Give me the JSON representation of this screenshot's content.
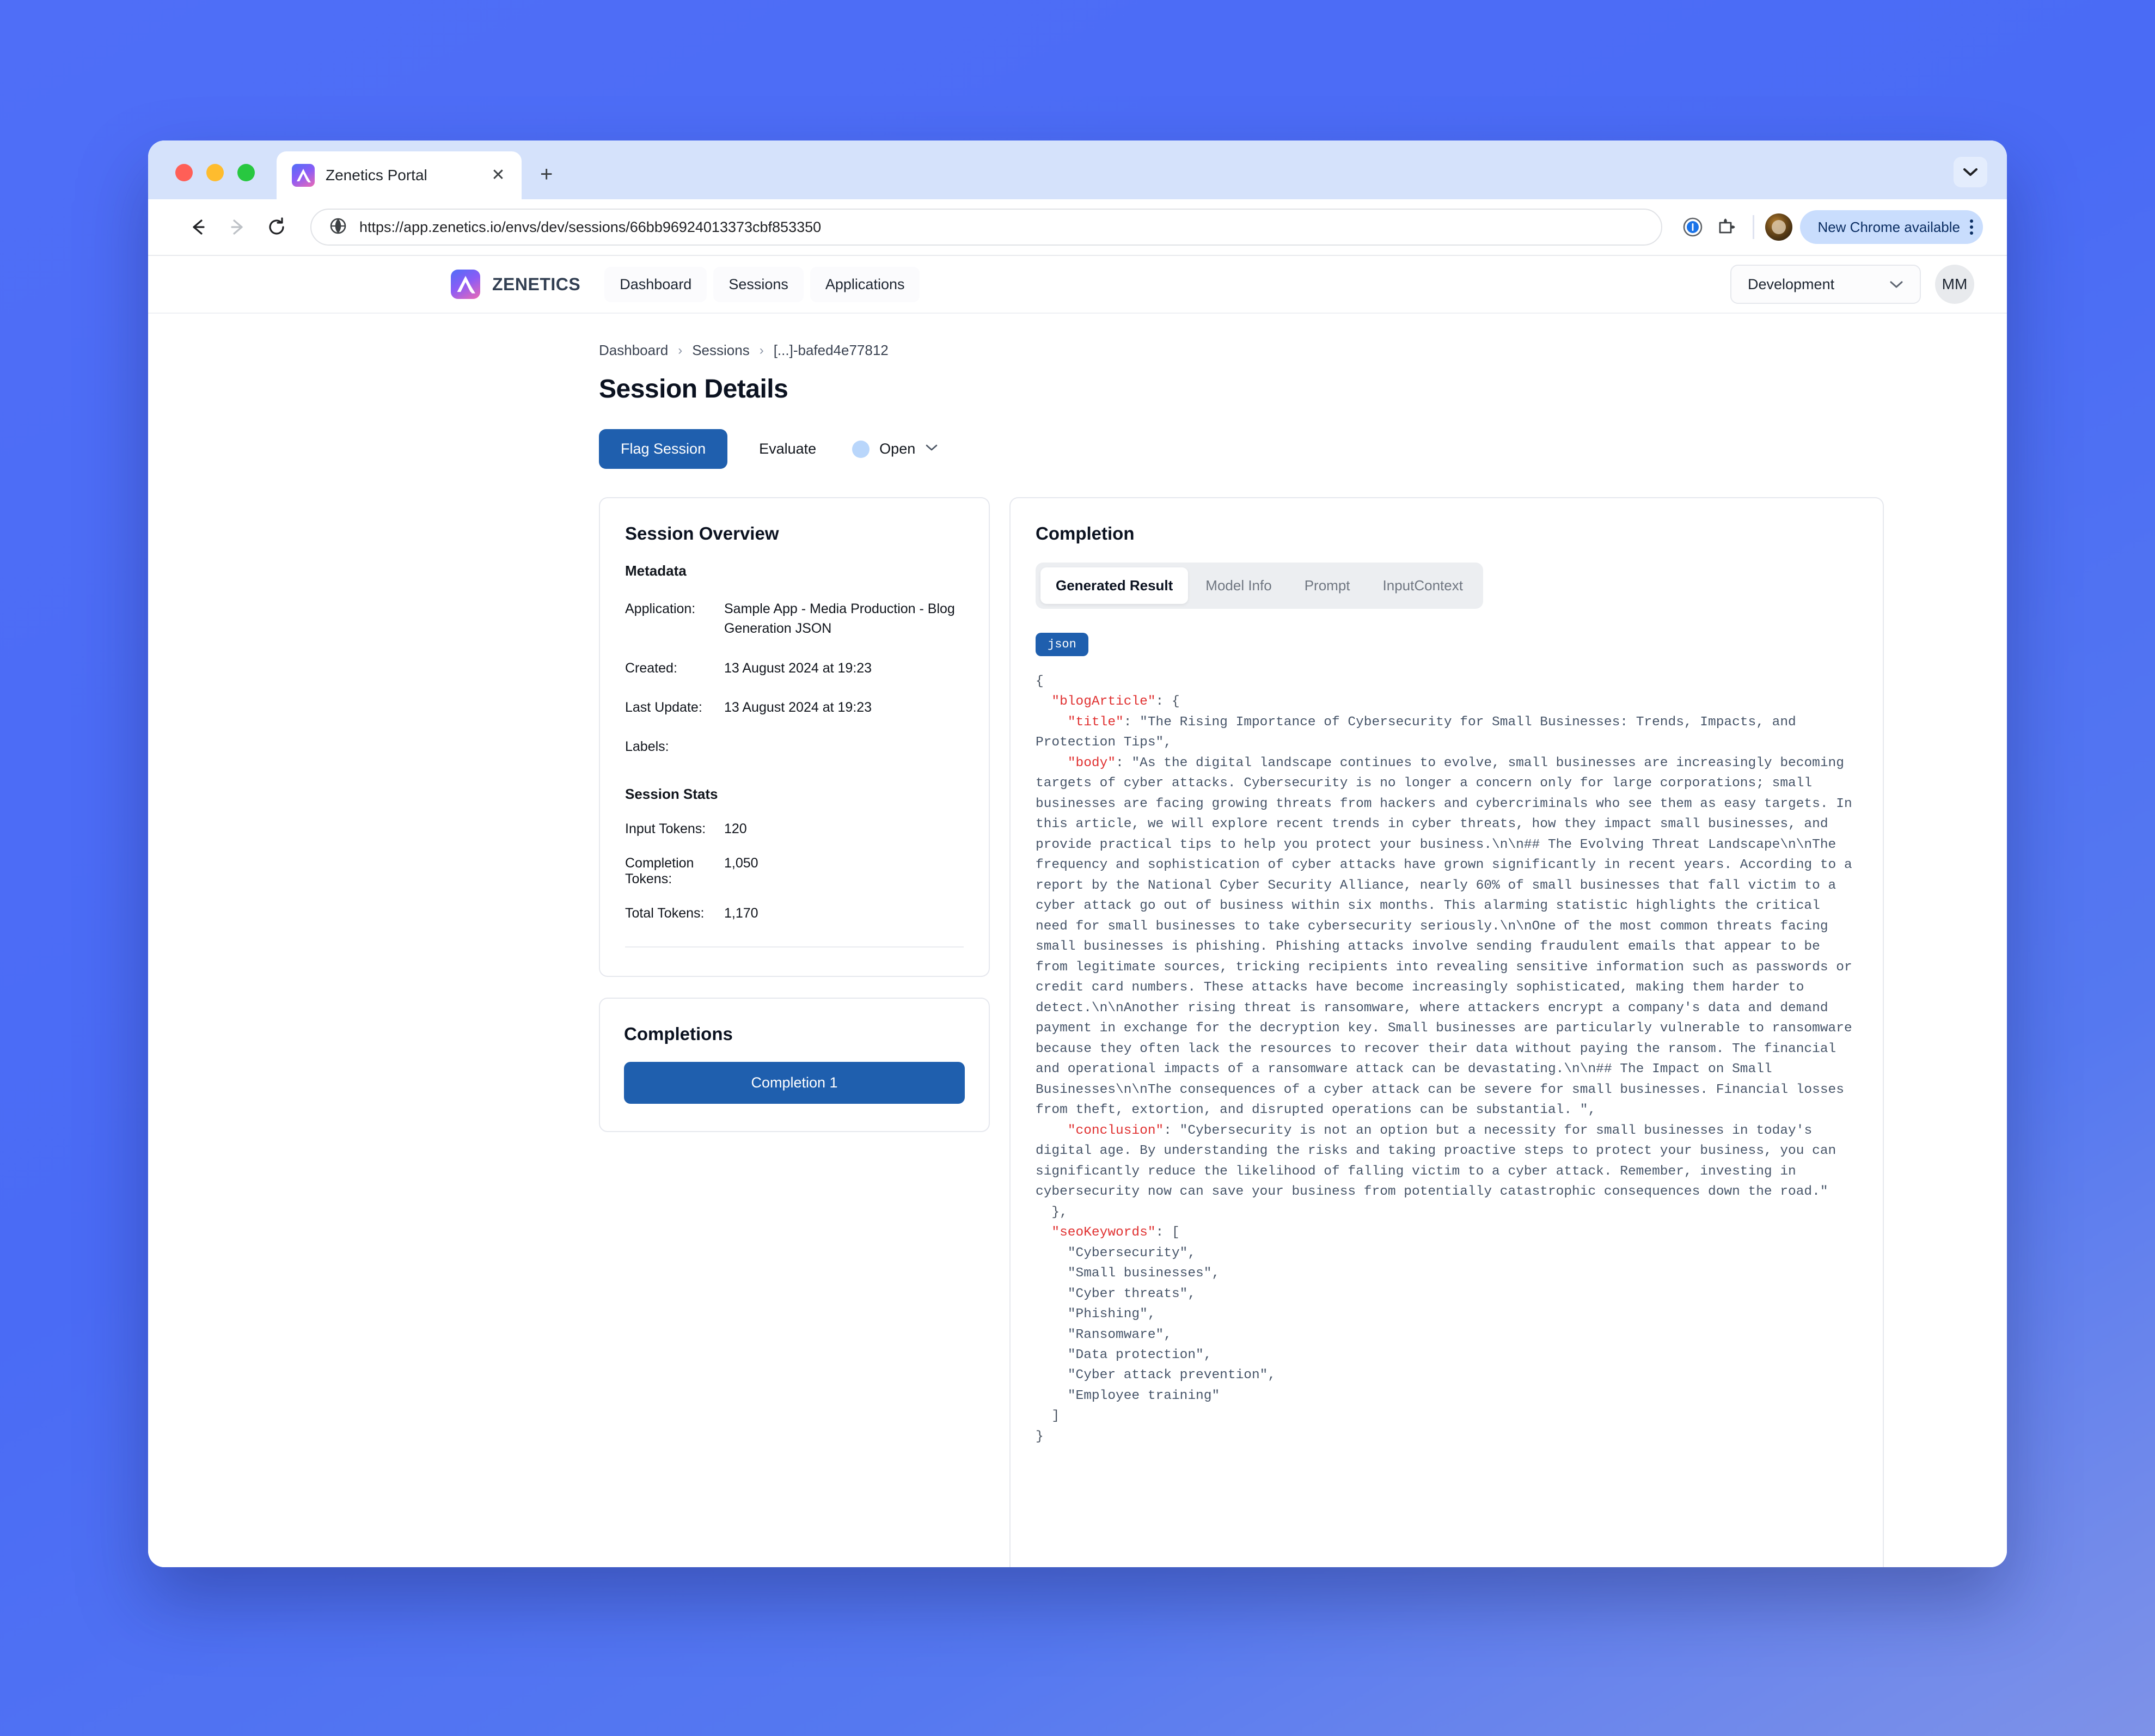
{
  "browser": {
    "tab": {
      "title": "Zenetics Portal",
      "favicon": "mountain-logo-icon",
      "close": "✕"
    },
    "new_tab_label": "+",
    "url": "https://app.zenetics.io/envs/dev/sessions/66bb96924013373cbf853350",
    "update_pill": "New Chrome available",
    "nav": {
      "back": "back-icon",
      "forward": "forward-icon",
      "reload": "reload-icon"
    }
  },
  "app": {
    "brand": "ZENETICS",
    "nav_links": [
      "Dashboard",
      "Sessions",
      "Applications"
    ],
    "env": "Development",
    "user_initials": "MM"
  },
  "breadcrumb": [
    "Dashboard",
    "Sessions",
    "[...]-bafed4e77812"
  ],
  "page_title": "Session Details",
  "actions": {
    "flag_session": "Flag Session",
    "evaluate": "Evaluate",
    "status": "Open"
  },
  "overview": {
    "title": "Session Overview",
    "metadata_heading": "Metadata",
    "metadata": [
      {
        "label": "Application:",
        "value": "Sample App - Media Production - Blog Generation JSON"
      },
      {
        "label": "Created:",
        "value": "13 August 2024 at 19:23"
      },
      {
        "label": "Last Update:",
        "value": "13 August 2024 at 19:23"
      },
      {
        "label": "Labels:",
        "value": ""
      }
    ],
    "stats_heading": "Session Stats",
    "stats": [
      {
        "label": "Input Tokens:",
        "value": "120"
      },
      {
        "label": "Completion Tokens:",
        "value": "1,050"
      },
      {
        "label": "Total Tokens:",
        "value": "1,170"
      }
    ]
  },
  "completions": {
    "title": "Completions",
    "items": [
      "Completion 1"
    ]
  },
  "completion": {
    "title": "Completion",
    "tabs": [
      {
        "label": "Generated Result",
        "active": true
      },
      {
        "label": "Model Info",
        "active": false
      },
      {
        "label": "Prompt",
        "active": false
      },
      {
        "label": "InputContext",
        "active": false
      }
    ],
    "language_badge": "json",
    "code": {
      "keys": {
        "blogArticle": "\"blogArticle\"",
        "title": "\"title\"",
        "body": "\"body\"",
        "conclusion": "\"conclusion\"",
        "seoKeywords": "\"seoKeywords\""
      },
      "title_value": "\"The Rising Importance of Cybersecurity for Small Businesses: Trends, Impacts, and Protection Tips\",",
      "body_value": "\"As the digital landscape continues to evolve, small businesses are increasingly becoming targets of cyber attacks. Cybersecurity is no longer a concern only for large corporations; small businesses are facing growing threats from hackers and cybercriminals who see them as easy targets. In this article, we will explore recent trends in cyber threats, how they impact small businesses, and provide practical tips to help you protect your business.\\n\\n## The Evolving Threat Landscape\\n\\nThe frequency and sophistication of cyber attacks have grown significantly in recent years. According to a report by the National Cyber Security Alliance, nearly 60% of small businesses that fall victim to a cyber attack go out of business within six months. This alarming statistic highlights the critical need for small businesses to take cybersecurity seriously.\\n\\nOne of the most common threats facing small businesses is phishing. Phishing attacks involve sending fraudulent emails that appear to be from legitimate sources, tricking recipients into revealing sensitive information such as passwords or credit card numbers. These attacks have become increasingly sophisticated, making them harder to detect.\\n\\nAnother rising threat is ransomware, where attackers encrypt a company's data and demand payment in exchange for the decryption key. Small businesses are particularly vulnerable to ransomware because they often lack the resources to recover their data without paying the ransom. The financial and operational impacts of a ransomware attack can be devastating.\\n\\n## The Impact on Small Businesses\\n\\nThe consequences of a cyber attack can be severe for small businesses. Financial losses from theft, extortion, and disrupted operations can be substantial. \",",
      "conclusion_value": "\"Cybersecurity is not an option but a necessity for small businesses in today's digital age. By understanding the risks and taking proactive steps to protect your business, you can significantly reduce the likelihood of falling victim to a cyber attack. Remember, investing in cybersecurity now can save your business from potentially catastrophic consequences down the road.\"",
      "seo_keywords": [
        "\"Cybersecurity\",",
        "\"Small businesses\",",
        "\"Cyber threats\",",
        "\"Phishing\",",
        "\"Ransomware\",",
        "\"Data protection\",",
        "\"Cyber attack prevention\",",
        "\"Employee training\""
      ],
      "punct": {
        "open_brace": "{",
        "close_brace": "}",
        "colon_open_brace": ": {",
        "close_brace_comma": "},",
        "colon_open_bracket": ": [",
        "close_bracket": "]",
        "colon": ": "
      }
    }
  },
  "colors": {
    "brand_blue": "#1f5fae",
    "desktop_bg": "#4a6bf5",
    "tab_strip": "#d5e2fb",
    "code_key": "#e03131",
    "code_text": "#475569",
    "status_dot": "#b9d6fb",
    "update_pill": "#c9ddfd"
  }
}
